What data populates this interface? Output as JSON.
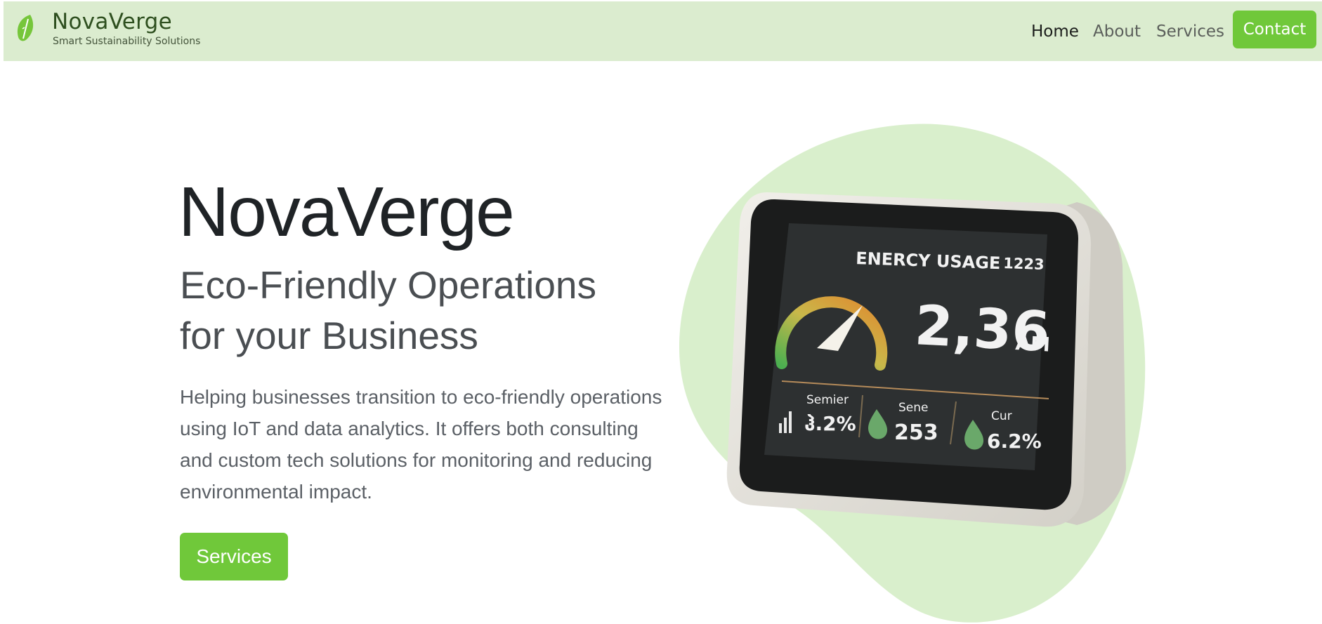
{
  "header": {
    "brand_name": "NovaVerge",
    "brand_tagline": "Smart Sustainability Solutions",
    "brand_icon": "leaf-icon",
    "nav": [
      {
        "label": "Home",
        "active": true
      },
      {
        "label": "About",
        "active": false
      },
      {
        "label": "Services",
        "active": false
      }
    ],
    "contact_label": "Contact"
  },
  "hero": {
    "title": "NovaVerge",
    "subtitle": "Eco-Friendly Operations for your Business",
    "description": "Helping businesses transition to eco-friendly operations using IoT and data analytics. It offers both consulting and custom tech solutions for monitoring and reducing environmental impact.",
    "button_label": "Services"
  },
  "device_screen": {
    "heading": "ENERCY USAGE",
    "code": "1223",
    "big_value": "2,36",
    "big_unit": "AM",
    "stats": [
      {
        "label": "Semier",
        "value": "ჰ.2%",
        "icon": "signal-bars-icon"
      },
      {
        "label": "Sene",
        "value": "253",
        "icon": "water-drop-icon"
      },
      {
        "label": "Cur",
        "value": "6.2%",
        "icon": "water-drop-icon"
      }
    ]
  },
  "colors": {
    "nav_background": "#dbeccf",
    "accent_green": "#70c83a",
    "blob_green": "#d9efcc",
    "brand_text": "#2e4f1f"
  }
}
